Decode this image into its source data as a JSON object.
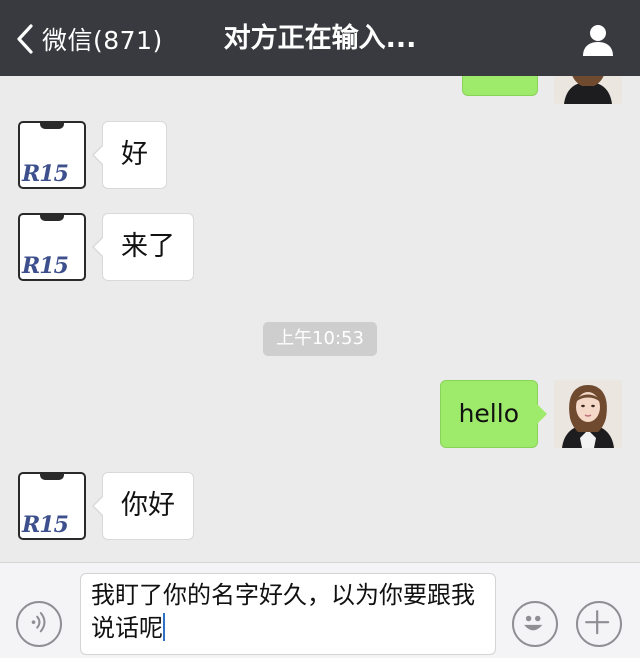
{
  "header": {
    "back_label": "微信(871)",
    "title": "对方正在输入..."
  },
  "messages": [
    {
      "direction": "in",
      "text": "好"
    },
    {
      "direction": "in",
      "text": "来了"
    },
    {
      "timestamp": "上午10:53"
    },
    {
      "direction": "out",
      "text": "hello"
    },
    {
      "direction": "in",
      "text": "你好"
    }
  ],
  "contact_avatar": {
    "label": "R15"
  },
  "input": {
    "value": "我盯了你的名字好久，以为你要跟我说话呢"
  },
  "colors": {
    "nav_bg": "#393a3f",
    "chat_bg": "#ebebeb",
    "outgoing_bubble": "#9eea6a",
    "incoming_bubble": "#ffffff"
  },
  "icons": {
    "back": "chevron-left-icon",
    "profile": "person-icon",
    "voice": "voice-icon",
    "emoji": "emoji-icon",
    "more": "plus-icon"
  }
}
